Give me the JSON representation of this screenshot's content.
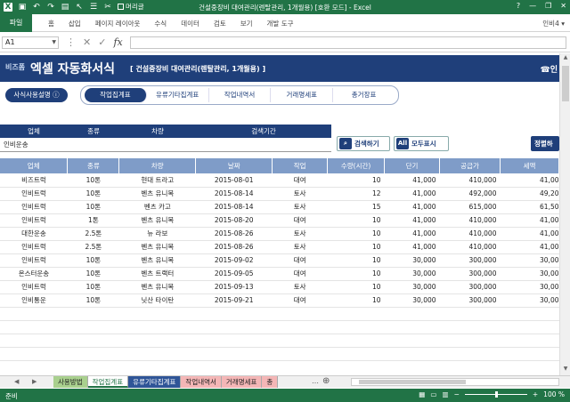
{
  "window": {
    "title": "건설중장비 대여관리(렌탈관리, 1개월용) [호환 모드] - Excel",
    "checkbox_label": "머리글",
    "buttons": [
      "?",
      "—",
      "❐",
      "✕"
    ]
  },
  "ribbon": {
    "file": "파일",
    "tabs": [
      "홈",
      "삽입",
      "페이지 레이아웃",
      "수식",
      "데이터",
      "검토",
      "보기",
      "개발 도구"
    ],
    "user": "인비4 ▾"
  },
  "formula_bar": {
    "name_box": "A1",
    "value": ""
  },
  "banner": {
    "brand": "비즈폼",
    "title": "엑셀 자동화서식",
    "subtitle": "[ 건설중장비 대여관리(렌탈관리, 1개월용) ]",
    "phone": "☎인"
  },
  "help_button": "사식사용설명 ⓘ",
  "nav_tabs": [
    "작업집계표",
    "유류기타집계표",
    "작업내역서",
    "거래명세표",
    "총거장표"
  ],
  "search": {
    "headers": [
      "업체",
      "종류",
      "차량",
      "검색기간"
    ],
    "values": [
      "인비운송",
      "",
      "",
      ""
    ],
    "search_button": "검색하기",
    "show_all_button": "모두표시",
    "sort_button": "정렬하"
  },
  "table": {
    "headers": [
      "업체",
      "종류",
      "차량",
      "날짜",
      "작업",
      "수량(시간)",
      "단기",
      "공급가",
      "세액"
    ],
    "rows": [
      [
        "비즈트럭",
        "10톤",
        "현대 트라고",
        "2015-08-01",
        "대여",
        "10",
        "41,000",
        "410,000",
        "41,00"
      ],
      [
        "인비트럭",
        "10톤",
        "벤츠 유니목",
        "2015-08-14",
        "토사",
        "12",
        "41,000",
        "492,000",
        "49,20"
      ],
      [
        "인비트럭",
        "10톤",
        "벤츠 카고",
        "2015-08-14",
        "토사",
        "15",
        "41,000",
        "615,000",
        "61,50"
      ],
      [
        "인비트럭",
        "1톤",
        "벤츠 유니목",
        "2015-08-20",
        "대여",
        "10",
        "41,000",
        "410,000",
        "41,00"
      ],
      [
        "대한운송",
        "2.5톤",
        "뉴 라보",
        "2015-08-26",
        "토사",
        "10",
        "41,000",
        "410,000",
        "41,00"
      ],
      [
        "인비트럭",
        "2.5톤",
        "벤츠 유니목",
        "2015-08-26",
        "토사",
        "10",
        "41,000",
        "410,000",
        "41,00"
      ],
      [
        "인비트럭",
        "10톤",
        "벤츠 유니목",
        "2015-09-02",
        "대여",
        "10",
        "30,000",
        "300,000",
        "30,00"
      ],
      [
        "온스터운송",
        "10톤",
        "벤츠 트랙터",
        "2015-09-05",
        "대여",
        "10",
        "30,000",
        "300,000",
        "30,00"
      ],
      [
        "인비트럭",
        "10톤",
        "벤츠 유니목",
        "2015-09-13",
        "토사",
        "10",
        "30,000",
        "300,000",
        "30,00"
      ],
      [
        "인비통운",
        "10톤",
        "닛산 타이탄",
        "2015-09-21",
        "대여",
        "10",
        "30,000",
        "300,000",
        "30,00"
      ]
    ]
  },
  "sheet_tabs": [
    {
      "label": "사용방법",
      "style": "green"
    },
    {
      "label": "작업집계표",
      "style": "active"
    },
    {
      "label": "유류기타집계표",
      "style": "blue"
    },
    {
      "label": "작업내역서",
      "style": "red"
    },
    {
      "label": "거래명세표",
      "style": "red"
    },
    {
      "label": "총",
      "style": "red"
    }
  ],
  "status": {
    "ready": "준비",
    "zoom": "100 %"
  },
  "colors": {
    "excel_green": "#217346",
    "banner_navy": "#1f3f7a",
    "table_header": "#7f9cc8"
  }
}
